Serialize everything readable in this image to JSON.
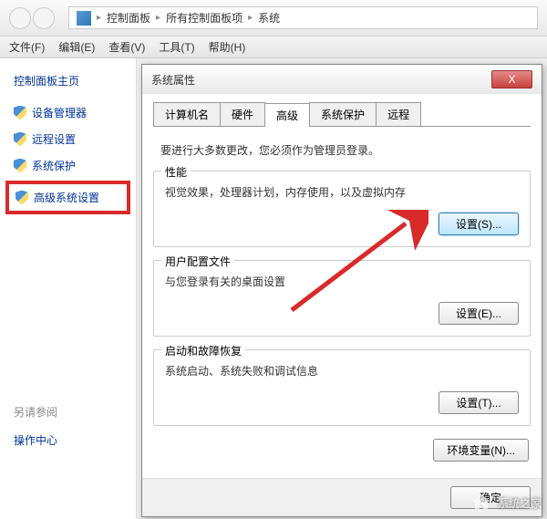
{
  "breadcrumb": {
    "a": "控制面板",
    "b": "所有控制面板项",
    "c": "系统"
  },
  "menu": {
    "file": "文件(F)",
    "edit": "编辑(E)",
    "view": "查看(V)",
    "tools": "工具(T)",
    "help": "帮助(H)"
  },
  "sidebar": {
    "title": "控制面板主页",
    "items": [
      "设备管理器",
      "远程设置",
      "系统保护",
      "高级系统设置"
    ],
    "see_also": "另请参阅",
    "action_center": "操作中心"
  },
  "dialog": {
    "title": "系统属性",
    "tabs": [
      "计算机名",
      "硬件",
      "高级",
      "系统保护",
      "远程"
    ],
    "active_tab": 2,
    "info": "要进行大多数更改，您必须作为管理员登录。",
    "perf": {
      "title": "性能",
      "desc": "视觉效果，处理器计划，内存使用，以及虚拟内存",
      "btn": "设置(S)..."
    },
    "profile": {
      "title": "用户配置文件",
      "desc": "与您登录有关的桌面设置",
      "btn": "设置(E)..."
    },
    "startup": {
      "title": "启动和故障恢复",
      "desc": "系统启动、系统失败和调试信息",
      "btn": "设置(T)..."
    },
    "env_btn": "环境变量(N)...",
    "ok": "确定",
    "close_x": "X"
  },
  "watermark": "系统之家"
}
